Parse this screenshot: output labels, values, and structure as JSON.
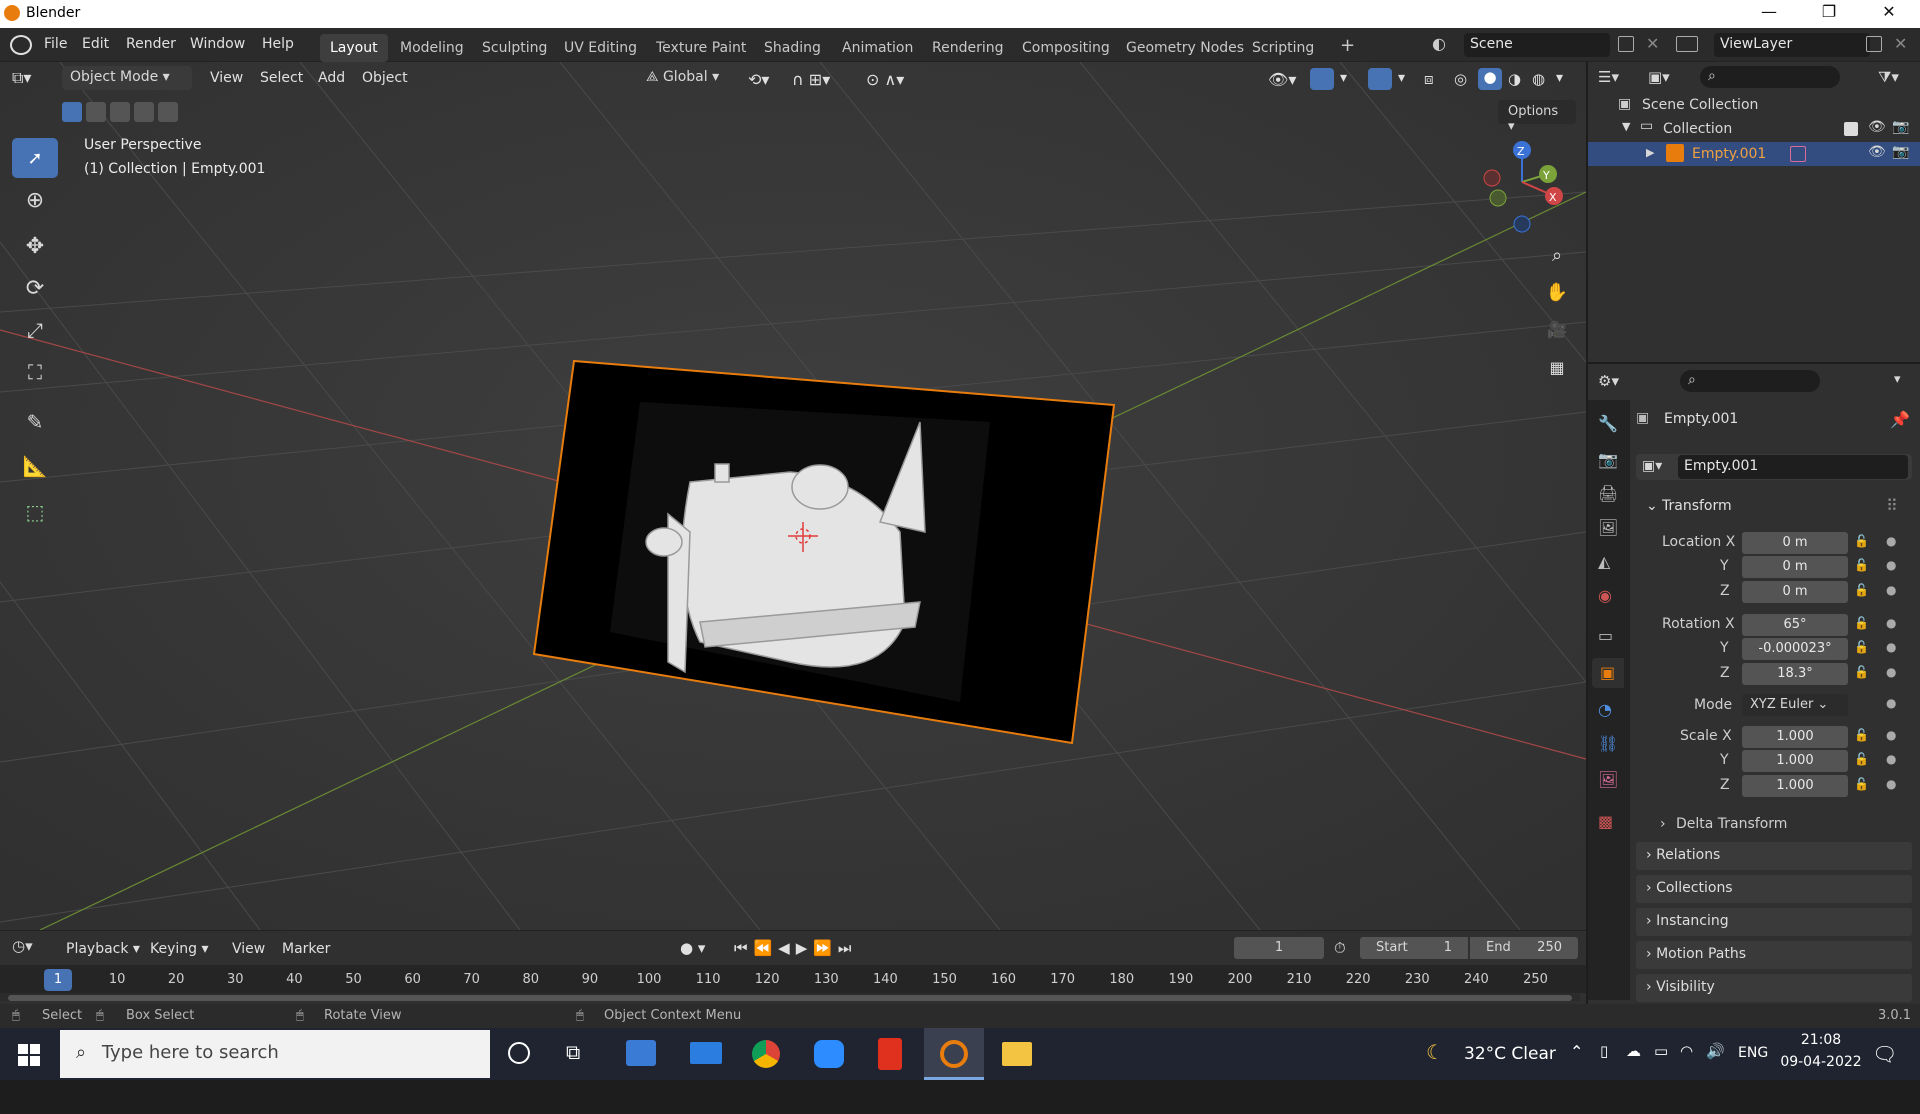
{
  "window": {
    "title": "Blender",
    "minimize": "—",
    "maximize": "❐",
    "close": "✕"
  },
  "menu": [
    "File",
    "Edit",
    "Render",
    "Window",
    "Help"
  ],
  "workspaces": [
    "Layout",
    "Modeling",
    "Sculpting",
    "UV Editing",
    "Texture Paint",
    "Shading",
    "Animation",
    "Rendering",
    "Compositing",
    "Geometry Nodes",
    "Scripting"
  ],
  "workspace_add": "+",
  "scene": {
    "name": "Scene",
    "view_layer": "ViewLayer"
  },
  "viewport_header": {
    "mode": "Object Mode",
    "menus": [
      "View",
      "Select",
      "Add",
      "Object"
    ],
    "orientation": "Global",
    "options": "Options"
  },
  "viewport": {
    "perspective": "User Perspective",
    "context": "(1) Collection | Empty.001",
    "gizmo": {
      "z": "Z",
      "y": "Y",
      "x": "X"
    }
  },
  "outliner": {
    "scene_collection": "Scene Collection",
    "collection": "Collection",
    "object": "Empty.001"
  },
  "properties": {
    "object_name": "Empty.001",
    "data_name": "Empty.001",
    "transform_title": "Transform",
    "location_label": "Location X",
    "rotation_label": "Rotation X",
    "scale_label": "Scale X",
    "y_label": "Y",
    "z_label": "Z",
    "location": [
      "0 m",
      "0 m",
      "0 m"
    ],
    "rotation": [
      "65°",
      "-0.000023°",
      "18.3°"
    ],
    "mode_label": "Mode",
    "mode_value": "XYZ Euler",
    "scale": [
      "1.000",
      "1.000",
      "1.000"
    ],
    "delta_transform": "Delta Transform",
    "sections": [
      "Relations",
      "Collections",
      "Instancing",
      "Motion Paths",
      "Visibility"
    ]
  },
  "timeline": {
    "menus": [
      "Playback",
      "Keying",
      "View",
      "Marker"
    ],
    "current_frame": "1",
    "start_label": "Start",
    "start": "1",
    "end_label": "End",
    "end": "250",
    "ticks": [
      "1",
      "10",
      "20",
      "30",
      "40",
      "50",
      "60",
      "70",
      "80",
      "90",
      "100",
      "110",
      "120",
      "130",
      "140",
      "150",
      "160",
      "170",
      "180",
      "190",
      "200",
      "210",
      "220",
      "230",
      "240",
      "250"
    ]
  },
  "statusbar": {
    "select": "Select",
    "box_select": "Box Select",
    "rotate_view": "Rotate View",
    "context_menu": "Object Context Menu",
    "version": "3.0.1"
  },
  "taskbar": {
    "search_placeholder": "Type here to search",
    "weather": "32°C  Clear",
    "lang": "ENG",
    "time": "21:08",
    "date": "09-04-2022"
  },
  "colors": {
    "accent": "#4772b3",
    "selection": "#e87d0d",
    "x_axis": "#d04545",
    "y_axis": "#7ca33a",
    "z_axis": "#3a72d6"
  }
}
